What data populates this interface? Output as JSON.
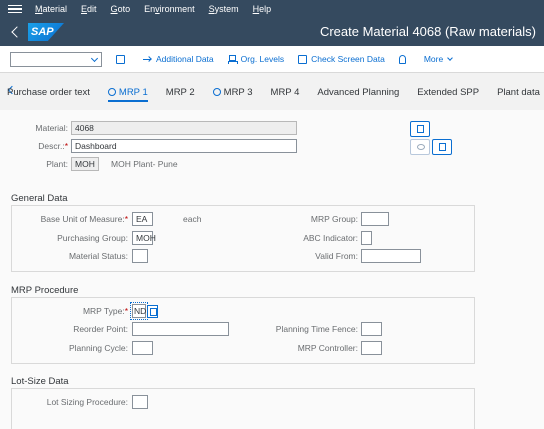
{
  "menu": [
    {
      "label": "Material",
      "u": "M"
    },
    {
      "label": "Edit",
      "u": "E"
    },
    {
      "label": "Goto",
      "u": "G"
    },
    {
      "label": "Environment",
      "u": "v"
    },
    {
      "label": "System",
      "u": "S"
    },
    {
      "label": "Help",
      "u": "H"
    }
  ],
  "shell": {
    "logo": "SAP",
    "title": "Create Material 4068 (Raw materials)"
  },
  "toolbar": {
    "combo_value": "",
    "additional_data": "Additional Data",
    "org_levels": "Org. Levels",
    "check_screen_data": "Check Screen Data",
    "more": "More"
  },
  "tabs": [
    "Purchase order text",
    "MRP 1",
    "MRP 2",
    "MRP 3",
    "MRP 4",
    "Advanced Planning",
    "Extended SPP",
    "Plant data"
  ],
  "active_tab": "MRP 1",
  "header": {
    "material_label": "Material:",
    "material_value": "4068",
    "descr_label": "Descr.:",
    "descr_required": "*",
    "descr_value": "Dashboard",
    "plant_label": "Plant:",
    "plant_value": "MOH",
    "plant_name": "MOH Plant- Pune"
  },
  "general": {
    "title": "General Data",
    "buom_label": "Base Unit of Measure:",
    "buom_req": "*",
    "buom_value": "EA",
    "buom_text": "each",
    "pgroup_label": "Purchasing Group:",
    "pgroup_value": "MOH",
    "mstatus_label": "Material Status:",
    "mstatus_value": "",
    "mrpgroup_label": "MRP Group:",
    "mrpgroup_value": "",
    "abc_label": "ABC Indicator:",
    "abc_value": "",
    "validfrom_label": "Valid From:",
    "validfrom_value": ""
  },
  "mrp": {
    "title": "MRP Procedure",
    "type_label": "MRP Type:",
    "type_req": "*",
    "type_value": "ND",
    "reorder_label": "Reorder Point:",
    "reorder_value": "",
    "cycle_label": "Planning Cycle:",
    "cycle_value": "",
    "ptf_label": "Planning Time Fence:",
    "ptf_value": "",
    "controller_label": "MRP Controller:",
    "controller_value": ""
  },
  "lotsize": {
    "title": "Lot-Size Data",
    "proc_label": "Lot Sizing Procedure:",
    "proc_value": ""
  },
  "colors": {
    "shell": "#354a5f",
    "accent": "#0a6ed1",
    "required": "#bb0000"
  }
}
